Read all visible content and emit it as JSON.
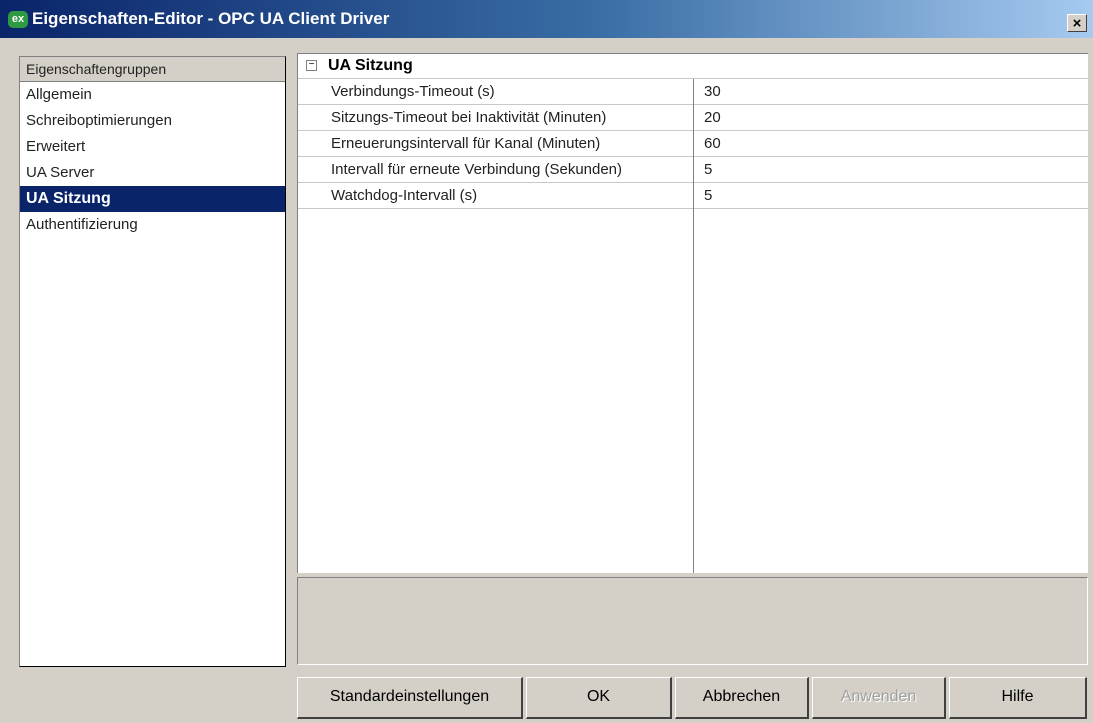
{
  "window": {
    "app_icon": "ex",
    "title": "Eigenschaften-Editor - OPC UA Client Driver",
    "close_glyph": "×"
  },
  "sidebar": {
    "header": "Eigenschaftengruppen",
    "items": [
      {
        "label": "Allgemein",
        "selected": false
      },
      {
        "label": "Schreiboptimierungen",
        "selected": false
      },
      {
        "label": "Erweitert",
        "selected": false
      },
      {
        "label": "UA Server",
        "selected": false
      },
      {
        "label": "UA Sitzung",
        "selected": true
      },
      {
        "label": "Authentifizierung",
        "selected": false
      }
    ]
  },
  "property_grid": {
    "group_expander": "−",
    "group_title": "UA Sitzung",
    "rows": [
      {
        "name": "Verbindungs-Timeout (s)",
        "value": "30"
      },
      {
        "name": "Sitzungs-Timeout bei Inaktivität (Minuten)",
        "value": "20"
      },
      {
        "name": "Erneuerungsintervall für Kanal (Minuten)",
        "value": "60"
      },
      {
        "name": "Intervall für erneute Verbindung (Sekunden)",
        "value": "5"
      },
      {
        "name": "Watchdog-Intervall (s)",
        "value": "5"
      }
    ]
  },
  "description": "",
  "buttons": {
    "defaults": "Standardeinstellungen",
    "ok": "OK",
    "cancel": "Abbrechen",
    "apply": "Anwenden",
    "help": "Hilfe"
  },
  "colors": {
    "selection": "#0a246a",
    "face": "#d4d0c8"
  },
  "icons": {
    "app": "ex-app-icon",
    "close": "close-icon",
    "expand": "collapse-minus-icon"
  }
}
